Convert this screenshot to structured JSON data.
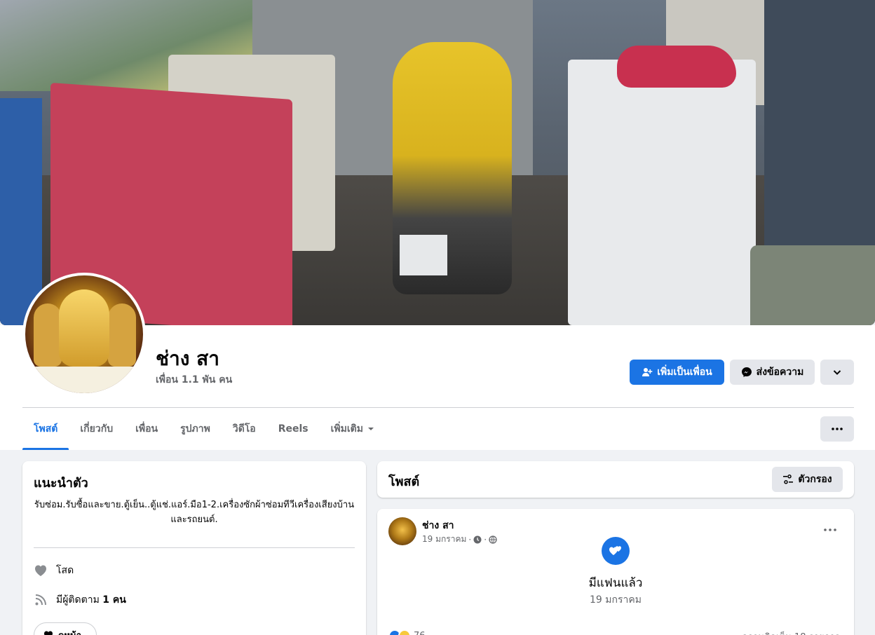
{
  "profile": {
    "name": "ช่าง สา",
    "friends_count": "เพื่อน 1.1 พัน คน"
  },
  "actions": {
    "add_friend": "เพิ่มเป็นเพื่อน",
    "message": "ส่งข้อความ"
  },
  "tabs": [
    {
      "label": "โพสต์",
      "active": true
    },
    {
      "label": "เกี่ยวกับ"
    },
    {
      "label": "เพื่อน"
    },
    {
      "label": "รูปภาพ"
    },
    {
      "label": "วิดีโอ"
    },
    {
      "label": "Reels"
    },
    {
      "label": "เพิ่มเติม"
    }
  ],
  "intro": {
    "title": "แนะนำตัว",
    "bio": "รับซ่อม.รับซื้อและขาย.ตู้เย็น..ตู้แช่.แอร์.มือ1-2.เครื่องซักผ้าซ่อมทีวีเครื่องเสียงบ้านและรถยนต์.",
    "relationship": "โสด",
    "followers_prefix": "มีผู้ติดตาม ",
    "followers_count": "1 คน",
    "edit_stub": "ดูหน้า"
  },
  "posts": {
    "title": "โพสต์",
    "filter_label": "ตัวกรอง"
  },
  "post": {
    "author": "ช่าง สา",
    "date": "19 มกราคม",
    "life_event_title": "มีแฟนแล้ว",
    "life_event_date": "19 มกราคม",
    "reaction_count": "76",
    "comment_count": "ความคิดเห็น 18 รายการ"
  },
  "colors": {
    "primary": "#1b74e4",
    "secondary_bg": "#e4e6eb",
    "page_bg": "#f0f2f5",
    "muted_text": "#65676b"
  }
}
